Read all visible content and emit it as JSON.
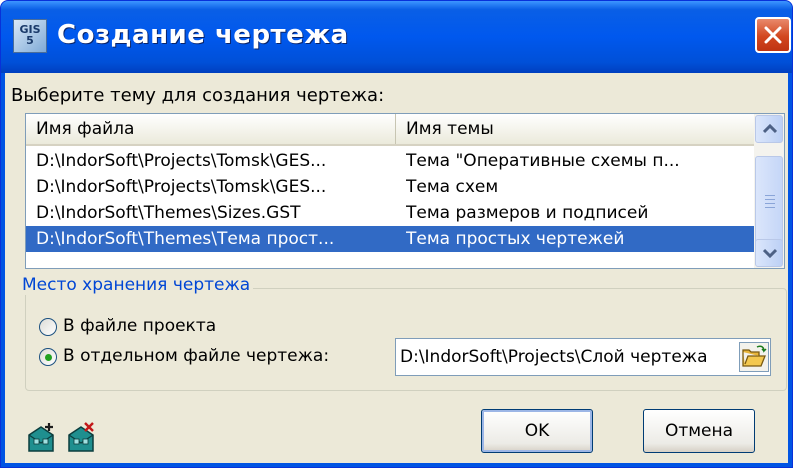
{
  "window": {
    "title": "Создание чертежа",
    "icon_name": "gis-app-icon",
    "icon_text": [
      "GIS",
      "5"
    ]
  },
  "prompt_label": "Выберите тему для создания чертежа:",
  "list": {
    "columns": [
      "Имя файла",
      "Имя темы"
    ],
    "rows": [
      {
        "file": "D:\\IndorSoft\\Projects\\Tomsk\\GES...",
        "theme": "Тема \"Оперативные схемы п...",
        "selected": false
      },
      {
        "file": "D:\\IndorSoft\\Projects\\Tomsk\\GES...",
        "theme": "Тема схем",
        "selected": false
      },
      {
        "file": "D:\\IndorSoft\\Themes\\Sizes.GST",
        "theme": "Тема размеров и подписей",
        "selected": false
      },
      {
        "file": "D:\\IndorSoft\\Themes\\Тема прост...",
        "theme": "Тема простых чертежей",
        "selected": true
      }
    ]
  },
  "storage": {
    "group_title": "Место хранения чертежа",
    "option_project": "В файле проекта",
    "option_separate": "В отдельном файле чертежа:",
    "selected_option": "separate",
    "path_value": "D:\\IndorSoft\\Projects\\Слой чертежа"
  },
  "buttons": {
    "ok": "OK",
    "cancel": "Отмена"
  },
  "icons": {
    "add": "add-theme-icon",
    "delete": "delete-theme-icon",
    "browse": "open-folder-icon",
    "close": "close-icon"
  },
  "colors": {
    "titlebar": "#0058ee",
    "selection": "#316ac5",
    "group_title": "#0046d5",
    "close_button": "#d2471f"
  }
}
